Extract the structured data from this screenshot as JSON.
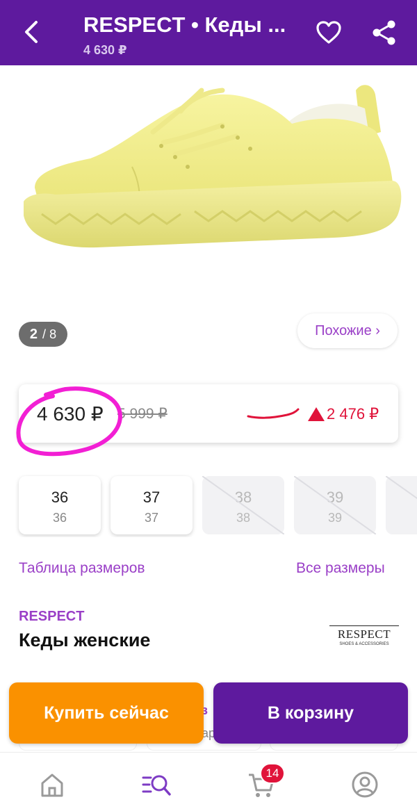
{
  "header": {
    "title": "RESPECT • Кеды ...",
    "subtitle": "4 630 ₽"
  },
  "gallery": {
    "current": "2",
    "total": "8",
    "similar_label": "Похожие ›"
  },
  "price": {
    "current": "4 630 ₽",
    "old": "5 999 ₽",
    "change": "2 476 ₽"
  },
  "sizes": [
    {
      "eu": "36",
      "ru": "36",
      "available": true
    },
    {
      "eu": "37",
      "ru": "37",
      "available": true
    },
    {
      "eu": "38",
      "ru": "38",
      "available": false
    },
    {
      "eu": "39",
      "ru": "39",
      "available": false
    }
  ],
  "links": {
    "size_table": "Таблица размеров",
    "all_sizes": "Все размеры"
  },
  "product": {
    "brand": "RESPECT",
    "name": "Кеды женские",
    "logo_word": "RESPECT",
    "logo_sub": "SHOES & ACCESSORIES"
  },
  "partial": {
    "line1": "з",
    "line2": "ар"
  },
  "actions": {
    "buy_now": "Купить сейчас",
    "add_to_cart": "В корзину"
  },
  "bottom_nav": {
    "cart_count": "14",
    "items": [
      "home-icon",
      "catalog-search-icon",
      "cart-icon",
      "profile-icon"
    ]
  },
  "colors": {
    "brand_purple": "#5e1a9e",
    "accent_orange": "#fa9100",
    "link_purple": "#9a3fc7",
    "price_red": "#e0133a",
    "annotation_magenta": "#f21fd4"
  }
}
